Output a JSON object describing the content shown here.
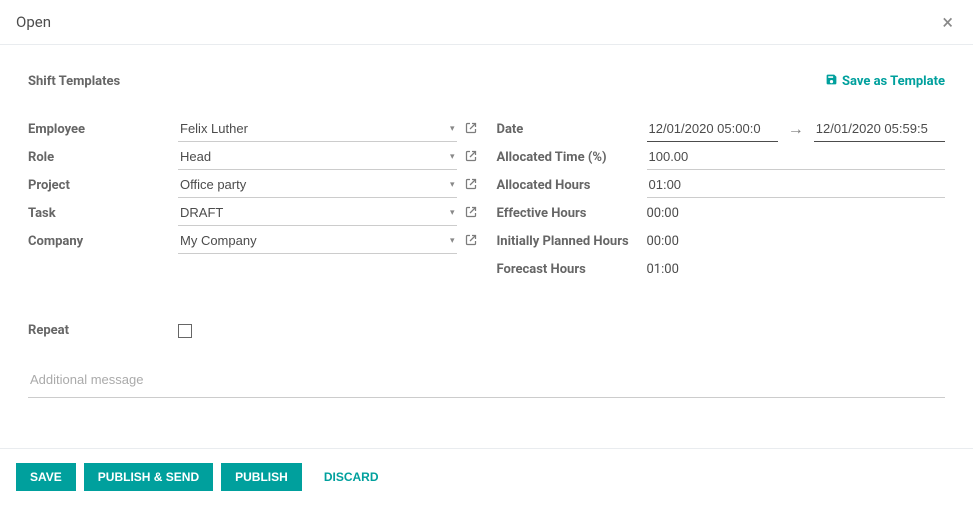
{
  "header": {
    "title": "Open"
  },
  "section": {
    "shift_templates": "Shift Templates",
    "save_as_template": "Save as Template"
  },
  "left": {
    "employee_label": "Employee",
    "employee_value": "Felix Luther",
    "role_label": "Role",
    "role_value": "Head",
    "project_label": "Project",
    "project_value": "Office party",
    "task_label": "Task",
    "task_value": "DRAFT",
    "company_label": "Company",
    "company_value": "My Company"
  },
  "right": {
    "date_label": "Date",
    "date_start": "12/01/2020 05:00:0",
    "date_end": "12/01/2020 05:59:5",
    "alloc_time_label": "Allocated Time (%)",
    "alloc_time_value": "100.00",
    "alloc_hours_label": "Allocated Hours",
    "alloc_hours_value": "01:00",
    "effective_label": "Effective Hours",
    "effective_value": "00:00",
    "planned_label": "Initially Planned Hours",
    "planned_value": "00:00",
    "forecast_label": "Forecast Hours",
    "forecast_value": "01:00"
  },
  "repeat": {
    "label": "Repeat",
    "checked": false
  },
  "additional_message_placeholder": "Additional message",
  "footer": {
    "save": "Save",
    "publish_send": "Publish & Send",
    "publish": "Publish",
    "discard": "Discard"
  }
}
